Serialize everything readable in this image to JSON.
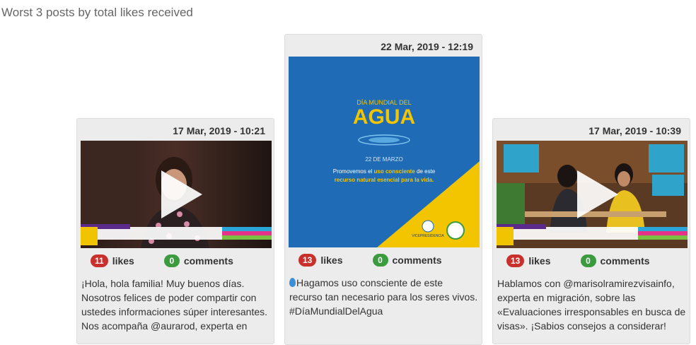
{
  "title": "Worst 3 posts by total likes received",
  "labels": {
    "likes": "likes",
    "comments": "comments"
  },
  "colors": {
    "likes_badge": "#c9302c",
    "comments_badge": "#3c9a3f",
    "card_bg": "#ececec",
    "agua_blue": "#1f6bb5",
    "agua_yellow": "#f2c500"
  },
  "posts": [
    {
      "date": "17 Mar, 2019 - 10:21",
      "likes": "11",
      "comments": "0",
      "text": "¡Hola, hola familia! Muy buenos días. Nosotros felices de poder compartir con ustedes informaciones súper interesantes. Nos acompaña @aurarod, experta en",
      "media": {
        "type": "video",
        "hashtag": "#tiemposolidario",
        "tag": "¡Economía para el hogar!",
        "caption": "\"La tristeza también influye en que las mujeres gasten más\"",
        "logo": "TIEMPO SOLIDARIO"
      }
    },
    {
      "date": "22 Mar, 2019 - 12:19",
      "likes": "13",
      "comments": "0",
      "text": "Hagamos uso consciente de este recurso tan necesario para los seres vivos. #DíaMundialDelAgua",
      "media": {
        "type": "image",
        "heading_small": "DÍA MUNDIAL DEL",
        "heading_big": "AGUA",
        "date_line": "22 DE MARZO",
        "line1_pre": "Promovemos el ",
        "line1_bold": "uso consciente",
        "line1_post": " de este",
        "line2": "recurso natural esencial para la vida.",
        "org": "VICEPRESIDENCIA"
      }
    },
    {
      "date": "17 Mar, 2019 - 10:39",
      "likes": "13",
      "comments": "0",
      "text": "Hablamos con @marisolramirezvisainfo, experta en migración, sobre las «Evaluaciones irresponsables en busca de visas». ¡Sabios consejos a considerar!",
      "media": {
        "type": "video",
        "tag": "@marisolramirezvisainfo",
        "caption": "\"No se puede hablar mentiras en el proceso de la visa\"",
        "logo": "TIEMPO SOLIDARIO"
      }
    }
  ]
}
